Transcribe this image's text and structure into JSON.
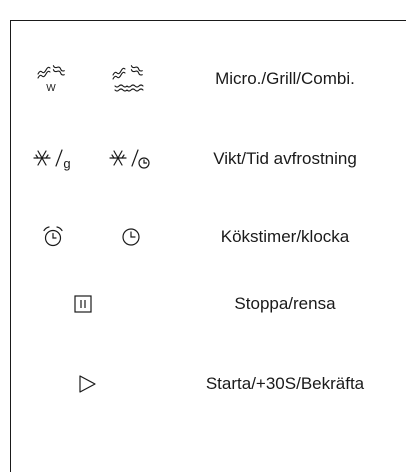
{
  "panel": {
    "rows": [
      {
        "label": "Micro./Grill/Combi.",
        "icons": [
          "micro-wave-w-icon",
          "grill-waves-icon"
        ],
        "icon_text": "W"
      },
      {
        "label": "Vikt/Tid avfrostning",
        "icons": [
          "defrost-weight-icon",
          "defrost-time-icon"
        ],
        "icon_text": "g"
      },
      {
        "label": "Kökstimer/klocka",
        "icons": [
          "alarm-clock-icon",
          "clock-icon"
        ]
      },
      {
        "label": "Stoppa/rensa",
        "icons": [
          "pause-stop-icon"
        ]
      },
      {
        "label": "Starta/+30S/Bekräfta",
        "icons": [
          "play-start-icon"
        ]
      }
    ]
  }
}
